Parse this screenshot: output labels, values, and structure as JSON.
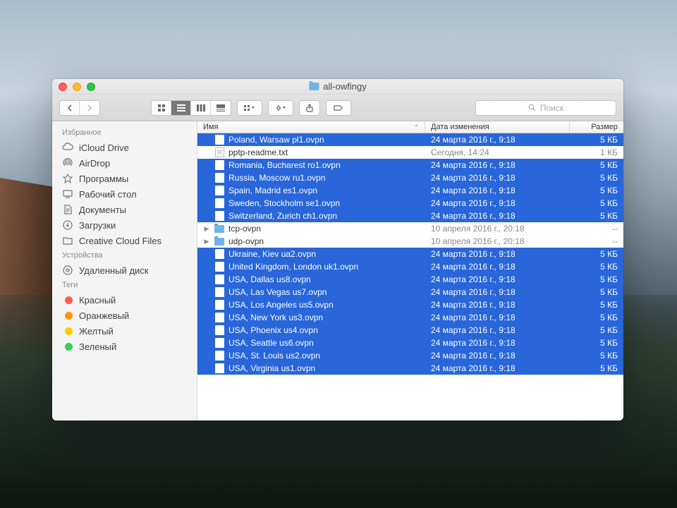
{
  "window": {
    "title": "all-owfingy"
  },
  "search": {
    "placeholder": "Поиск"
  },
  "sidebar": {
    "sections": [
      {
        "header": "Избранное",
        "items": [
          {
            "icon": "cloud",
            "label": "iCloud Drive"
          },
          {
            "icon": "airdrop",
            "label": "AirDrop"
          },
          {
            "icon": "apps",
            "label": "Программы"
          },
          {
            "icon": "desktop",
            "label": "Рабочий стол"
          },
          {
            "icon": "docs",
            "label": "Документы"
          },
          {
            "icon": "downloads",
            "label": "Загрузки"
          },
          {
            "icon": "folder",
            "label": "Creative Cloud Files"
          }
        ]
      },
      {
        "header": "Устройства",
        "items": [
          {
            "icon": "disc",
            "label": "Удаленный диск"
          }
        ]
      },
      {
        "header": "Теги",
        "items": [
          {
            "icon": "tag",
            "color": "#ff5a50",
            "label": "Красный"
          },
          {
            "icon": "tag",
            "color": "#ff9500",
            "label": "Оранжевый"
          },
          {
            "icon": "tag",
            "color": "#ffcc00",
            "label": "Желтый"
          },
          {
            "icon": "tag",
            "color": "#30d158",
            "label": "Зеленый"
          }
        ]
      }
    ]
  },
  "columns": {
    "name": "Имя",
    "date": "Дата изменения",
    "size": "Размер"
  },
  "files": [
    {
      "sel": true,
      "type": "ovpn",
      "name": "Poland, Warsaw pl1.ovpn",
      "date": "24 марта 2016 г., 9:18",
      "size": "5 КБ"
    },
    {
      "sel": false,
      "type": "txt",
      "name": "pptp-readme.txt",
      "date": "Сегодня, 14:24",
      "size": "1 КБ"
    },
    {
      "sel": true,
      "type": "ovpn",
      "name": "Romania, Bucharest ro1.ovpn",
      "date": "24 марта 2016 г., 9:18",
      "size": "5 КБ"
    },
    {
      "sel": true,
      "type": "ovpn",
      "name": "Russia, Moscow ru1.ovpn",
      "date": "24 марта 2016 г., 9:18",
      "size": "5 КБ"
    },
    {
      "sel": true,
      "type": "ovpn",
      "name": "Spain, Madrid es1.ovpn",
      "date": "24 марта 2016 г., 9:18",
      "size": "5 КБ"
    },
    {
      "sel": true,
      "type": "ovpn",
      "name": "Sweden, Stockholm se1.ovpn",
      "date": "24 марта 2016 г., 9:18",
      "size": "5 КБ"
    },
    {
      "sel": true,
      "type": "ovpn",
      "name": "Switzerland, Zurich ch1.ovpn",
      "date": "24 марта 2016 г., 9:18",
      "size": "5 КБ"
    },
    {
      "sel": false,
      "type": "folder",
      "expandable": true,
      "name": "tcp-ovpn",
      "date": "10 апреля 2016 г., 20:18",
      "size": "--"
    },
    {
      "sel": false,
      "type": "folder",
      "expandable": true,
      "name": "udp-ovpn",
      "date": "10 апреля 2016 г., 20:18",
      "size": "--"
    },
    {
      "sel": true,
      "type": "ovpn",
      "name": "Ukraine, Kiev ua2.ovpn",
      "date": "24 марта 2016 г., 9:18",
      "size": "5 КБ"
    },
    {
      "sel": true,
      "type": "ovpn",
      "name": "United Kingdom, London uk1.ovpn",
      "date": "24 марта 2016 г., 9:18",
      "size": "5 КБ"
    },
    {
      "sel": true,
      "type": "ovpn",
      "name": "USA, Dallas us8.ovpn",
      "date": "24 марта 2016 г., 9:18",
      "size": "5 КБ"
    },
    {
      "sel": true,
      "type": "ovpn",
      "name": "USA, Las Vegas us7.ovpn",
      "date": "24 марта 2016 г., 9:18",
      "size": "5 КБ"
    },
    {
      "sel": true,
      "type": "ovpn",
      "name": "USA, Los Angeles us5.ovpn",
      "date": "24 марта 2016 г., 9:18",
      "size": "5 КБ"
    },
    {
      "sel": true,
      "type": "ovpn",
      "name": "USA, New York us3.ovpn",
      "date": "24 марта 2016 г., 9:18",
      "size": "5 КБ"
    },
    {
      "sel": true,
      "type": "ovpn",
      "name": "USA, Phoenix us4.ovpn",
      "date": "24 марта 2016 г., 9:18",
      "size": "5 КБ"
    },
    {
      "sel": true,
      "type": "ovpn",
      "name": "USA, Seattle us6.ovpn",
      "date": "24 марта 2016 г., 9:18",
      "size": "5 КБ"
    },
    {
      "sel": true,
      "type": "ovpn",
      "name": "USA, St. Louis us2.ovpn",
      "date": "24 марта 2016 г., 9:18",
      "size": "5 КБ"
    },
    {
      "sel": true,
      "type": "ovpn",
      "name": "USA, Virginia us1.ovpn",
      "date": "24 марта 2016 г., 9:18",
      "size": "5 КБ"
    }
  ]
}
